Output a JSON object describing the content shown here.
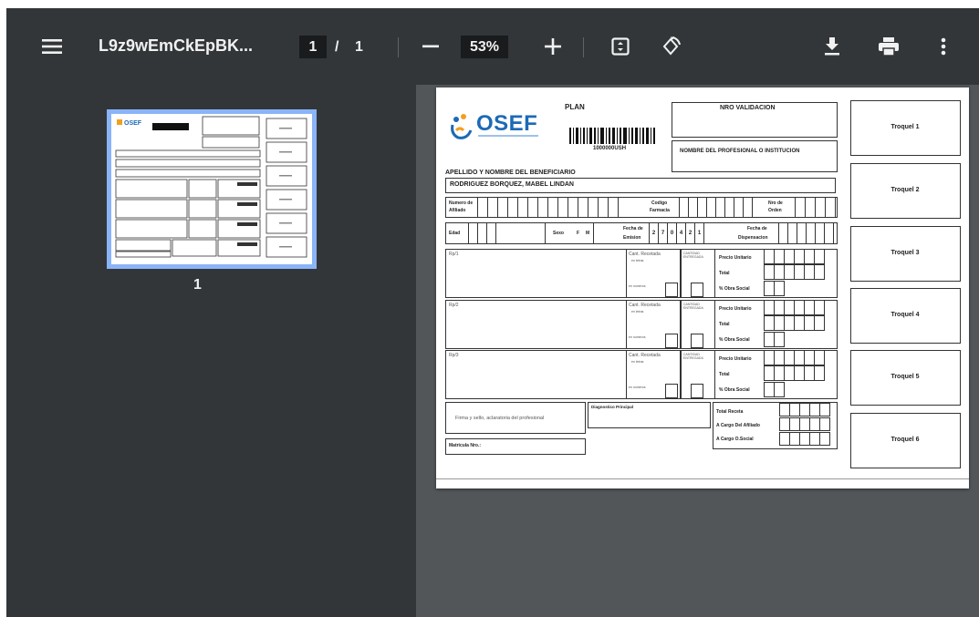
{
  "toolbar": {
    "title": "L9z9wEmCkEpBK...",
    "page_current": "1",
    "page_separator": "/",
    "page_total": "1",
    "zoom": "53%"
  },
  "sidebar": {
    "thumbnail_label": "1"
  },
  "document": {
    "logo_text": "OSEF",
    "plan_label": "PLAN",
    "barcode_number": "1000000USH",
    "nro_validacion": "NRO VALIDACION",
    "nombre_profesional": "NOMBRE DEL PROFESIONAL O INSTITUCION",
    "apellido_label": "APELLIDO Y NOMBRE DEL BENEFICIARIO",
    "beneficiario": "RODRIGUEZ BORQUEZ, MABEL LINDAN",
    "numero_afiliado_1": "Numero de",
    "numero_afiliado_2": "Afiliado",
    "codigo_farmacia_1": "Codigo",
    "codigo_farmacia_2": "Farmacia",
    "nro_orden_1": "Nro de",
    "nro_orden_2": "Orden",
    "edad": "Edad",
    "sexo": "Sexo",
    "sexo_f": "F",
    "sexo_m": "M",
    "fecha_emision_1": "Fecha de",
    "fecha_emision_2": "Emision",
    "fecha_digits": [
      "2",
      "7",
      "0",
      "4",
      "2",
      "1"
    ],
    "fecha_dispensacion_1": "Fecha de",
    "fecha_dispensacion_2": "Dispensacion",
    "rp_labels": [
      "Rp/1",
      "Rp/2",
      "Rp/3"
    ],
    "cant_recetada": "Cant. Recetada",
    "en_letras": "en letras",
    "en_numeros": "en numeros",
    "cantidad_entregada": "CANTIDAD ENTREGADA",
    "precio_unitario": "Precio Unitario",
    "total": "Total",
    "obra_social_pct": "% Obra Social",
    "firma": "Firma y sello, aclaratoria del profesional",
    "diagnostico": "Diagnostico Principal",
    "matricula": "Matricula Nro.:",
    "total_receta": "Total Receta",
    "a_cargo_afiliado": "A Cargo Del Afiliado",
    "a_cargo_os": "A Cargo O.Social",
    "troqueles": [
      "Troquel 1",
      "Troquel 2",
      "Troquel 3",
      "Troquel 4",
      "Troquel 5",
      "Troquel 6"
    ]
  },
  "icons": [
    "menu-icon",
    "minus-icon",
    "plus-icon",
    "fit-page-icon",
    "rotate-icon",
    "download-icon",
    "print-icon",
    "more-vert-icon"
  ],
  "colors": {
    "toolbar": "#323639",
    "viewer_bg": "#525659",
    "thumb_highlight": "#8ab4f8",
    "logo_blue": "#1c6ab6",
    "logo_orange": "#f0a020"
  }
}
